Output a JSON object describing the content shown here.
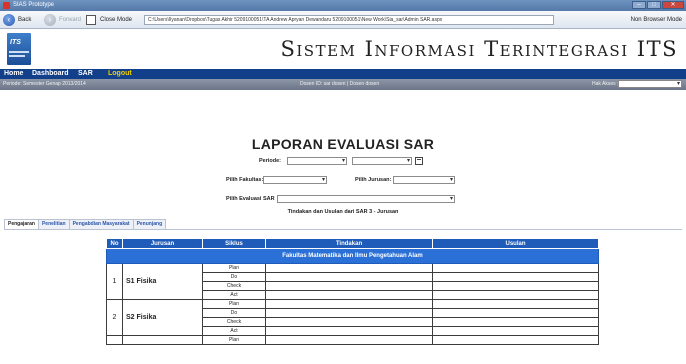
{
  "window": {
    "title": "SIAS Prototype",
    "controls": [
      "–",
      "□",
      "✕"
    ]
  },
  "toolbar": {
    "back_label": "Back",
    "forward_label": "Forward",
    "close_mode_label": "Close Mode",
    "address": "C:\\Users\\Ilyanan\\Dropbox\\Tugas Akhir 5209100051\\TA Andrew Apryan Dewandaru 5209100051\\New Work\\Sia_sar\\Admin SAR.aspx",
    "mode_label": "Non Browser Mode"
  },
  "header": {
    "logo_text": "ITS",
    "site_title": "Sistem Informasi Terintegrasi ITS"
  },
  "nav": {
    "home": "Home",
    "dashboard": "Dashboard",
    "sar": "SAR",
    "logout": "Logout"
  },
  "infobar": {
    "period": "Periode: Semester Genap 2013/2014",
    "user": "Dosen ID: sar dosen | Dosen dosen",
    "role_label": "Hak Akses :"
  },
  "report": {
    "title": "LAPORAN EVALUASI SAR",
    "periode_label": "Periode:",
    "fakultas_label": "Pilih Fakultas:",
    "jurusan_label": "Pilih Jurusan:",
    "evaluasi_label": "Pilih Evaluasi SAR",
    "caption": "Tindakan dan Usulan dari SAR 3 - Jurusan"
  },
  "tabs": [
    {
      "label": "Pengajaran",
      "active": true
    },
    {
      "label": "Penelitian",
      "active": false
    },
    {
      "label": "Pengabdian Masyarakat",
      "active": false
    },
    {
      "label": "Penunjang",
      "active": false
    }
  ],
  "table": {
    "headers": [
      "No",
      "Jurusan",
      "Siklus",
      "Tindakan",
      "Usulan"
    ],
    "faculty": "Fakultas Matematika dan Ilmu Pengetahuan Alam",
    "rows": [
      {
        "no": "1",
        "jurusan": "S1 Fisika",
        "siklus": [
          "Plan",
          "Do",
          "Check",
          "Act"
        ]
      },
      {
        "no": "2",
        "jurusan": "S2 Fisika",
        "siklus": [
          "Plan",
          "Do",
          "Check",
          "Act"
        ]
      },
      {
        "no": "",
        "jurusan": "",
        "siklus": [
          "Plan"
        ]
      }
    ]
  }
}
